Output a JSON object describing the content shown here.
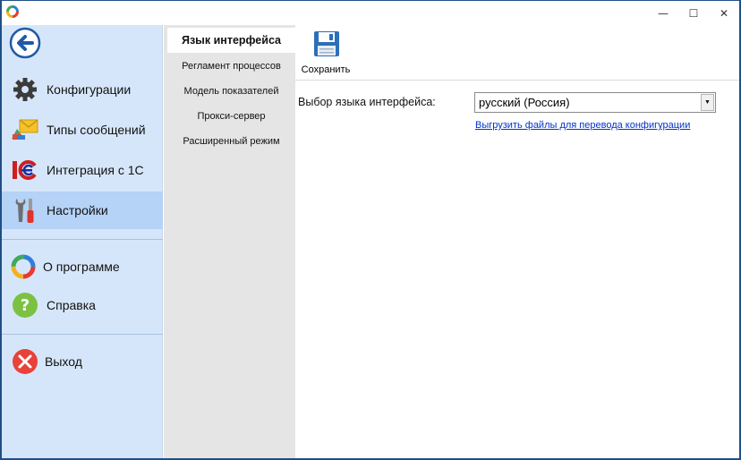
{
  "window": {
    "minimize_glyph": "—",
    "maximize_glyph": "☐",
    "close_glyph": "✕"
  },
  "sidebar": {
    "items": [
      {
        "label": "Конфигурации",
        "icon": "gear-icon"
      },
      {
        "label": "Типы сообщений",
        "icon": "message-types-icon"
      },
      {
        "label": "Интеграция с 1С",
        "icon": "1c-icon"
      },
      {
        "label": "Настройки",
        "icon": "tools-icon",
        "active": true
      },
      {
        "label": "О программе",
        "icon": "about-icon"
      },
      {
        "label": "Справка",
        "icon": "help-icon"
      },
      {
        "label": "Выход",
        "icon": "exit-icon"
      }
    ]
  },
  "subnav": {
    "items": [
      {
        "label": "Язык интерфейса",
        "active": true
      },
      {
        "label": "Регламент процессов"
      },
      {
        "label": "Модель показателей"
      },
      {
        "label": "Прокси-сервер"
      },
      {
        "label": "Расширенный режим"
      }
    ]
  },
  "toolbar": {
    "save_label": "Сохранить"
  },
  "settings": {
    "language_label": "Выбор языка интерфейса:",
    "language_value": "русский (Россия)",
    "export_link": "Выгрузить файлы для перевода конфигурации"
  },
  "colors": {
    "sidebar_bg": "#d6e6fa",
    "sidebar_active": "#b5d2f7",
    "subnav_bg": "#e5e5e5",
    "link": "#0033cc",
    "window_border": "#1f4f86"
  }
}
